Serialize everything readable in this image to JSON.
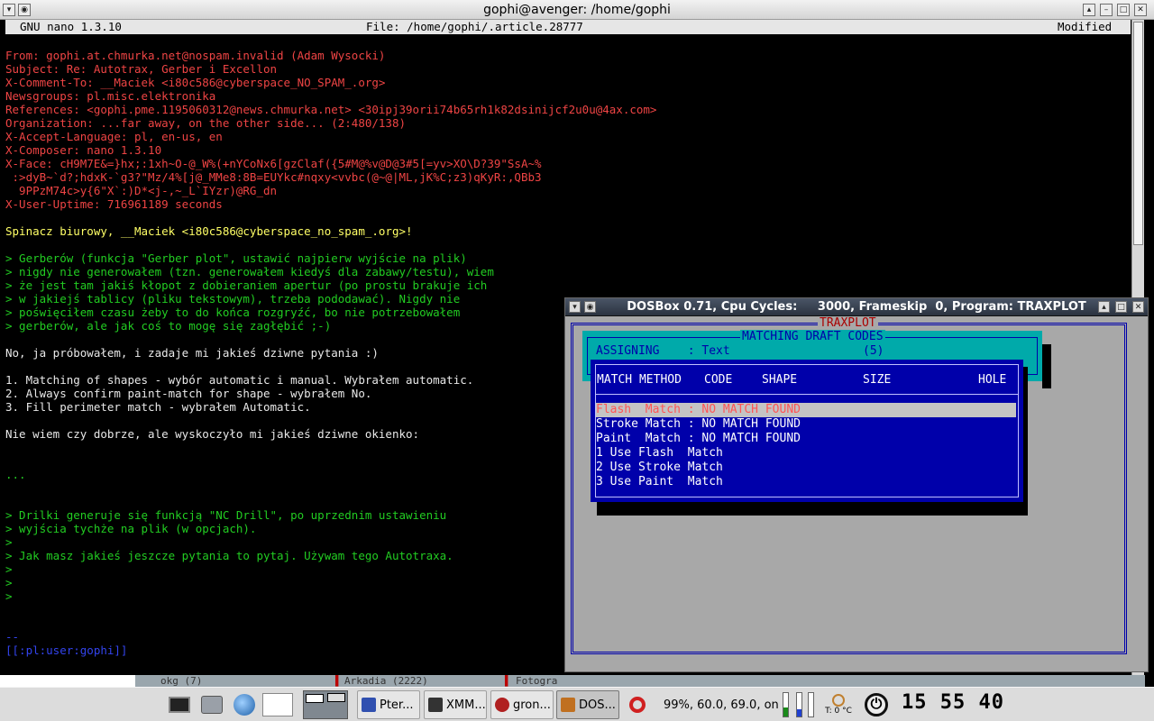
{
  "terminal": {
    "title": "gophi@avenger: /home/gophi",
    "nano": {
      "version": "GNU nano 1.3.10",
      "file": "File: /home/gophi/.article.28777",
      "status": "Modified"
    },
    "lines": [
      {
        "c": "red",
        "t": "From: gophi.at.chmurka.net@nospam.invalid (Adam Wysocki)"
      },
      {
        "c": "red",
        "t": "Subject: Re: Autotrax, Gerber i Excellon"
      },
      {
        "c": "red",
        "t": "X-Comment-To: __Maciek <i80c586@cyberspace_NO_SPAM_.org>"
      },
      {
        "c": "red",
        "t": "Newsgroups: pl.misc.elektronika"
      },
      {
        "c": "red",
        "t": "References: <gophi.pme.1195060312@news.chmurka.net> <30ipj39orii74b65rh1k82dsinijcf2u0u@4ax.com>"
      },
      {
        "c": "red",
        "t": "Organization: ...far away, on the other side... (2:480/138)"
      },
      {
        "c": "red",
        "t": "X-Accept-Language: pl, en-us, en"
      },
      {
        "c": "red",
        "t": "X-Composer: nano 1.3.10"
      },
      {
        "c": "red",
        "t": "X-Face: cH9M7E&=}hx;:1xh~O-@_W%(+nYCoNx6[gzClaf({5#M@%v@D@3#5[=yv>XO\\D?39\"SsA~%"
      },
      {
        "c": "red",
        "t": " :>dyB~`d?;hdxK-`g3?\"Mz/4%[j@_MMe8:8B=EUYkc#nqxy<vvbc(@~@|ML,jK%C;z3)qKyR:,QBb3"
      },
      {
        "c": "red",
        "t": "  9PPzM74c>y{6\"X`:)D*<j-,~_L`IYzr)@RG_dn"
      },
      {
        "c": "red",
        "t": "X-User-Uptime: 716961189 seconds"
      },
      {
        "c": "wht",
        "t": ""
      },
      {
        "c": "yel",
        "t": "Spinacz biurowy, __Maciek <i80c586@cyberspace_no_spam_.org>!"
      },
      {
        "c": "wht",
        "t": ""
      },
      {
        "c": "grn",
        "t": "> Gerberów (funkcja \"Gerber plot\", ustawić najpierw wyjście na plik)"
      },
      {
        "c": "grn",
        "t": "> nigdy nie generowałem (tzn. generowałem kiedyś dla zabawy/testu), wiem"
      },
      {
        "c": "grn",
        "t": "> że jest tam jakiś kłopot z dobieraniem apertur (po prostu brakuje ich"
      },
      {
        "c": "grn",
        "t": "> w jakiejś tablicy (pliku tekstowym), trzeba pododawać). Nigdy nie"
      },
      {
        "c": "grn",
        "t": "> poświęciłem czasu żeby to do końca rozgryźć, bo nie potrzebowałem"
      },
      {
        "c": "grn",
        "t": "> gerberów, ale jak coś to mogę się zagłębić ;-)"
      },
      {
        "c": "wht",
        "t": ""
      },
      {
        "c": "wht",
        "t": "No, ja próbowałem, i zadaje mi jakieś dziwne pytania :)"
      },
      {
        "c": "wht",
        "t": ""
      },
      {
        "c": "wht",
        "t": "1. Matching of shapes - wybór automatic i manual. Wybrałem automatic."
      },
      {
        "c": "wht",
        "t": "2. Always confirm paint-match for shape - wybrałem No."
      },
      {
        "c": "wht",
        "t": "3. Fill perimeter match - wybrałem Automatic."
      },
      {
        "c": "wht",
        "t": ""
      },
      {
        "c": "wht",
        "t": "Nie wiem czy dobrze, ale wyskoczyło mi jakieś dziwne okienko:"
      },
      {
        "c": "wht",
        "t": ""
      },
      {
        "c": "wht",
        "t": ""
      },
      {
        "c": "grn",
        "t": "..."
      },
      {
        "c": "wht",
        "t": ""
      },
      {
        "c": "wht",
        "t": ""
      },
      {
        "c": "grn",
        "t": "> Drilki generuje się funkcją \"NC Drill\", po uprzednim ustawieniu"
      },
      {
        "c": "grn",
        "t": "> wyjścia tychże na plik (w opcjach)."
      },
      {
        "c": "grn",
        "t": ">"
      },
      {
        "c": "grn",
        "t": "> Jak masz jakieś jeszcze pytania to pytaj. Używam tego Autotraxa."
      },
      {
        "c": "grn",
        "t": ">"
      },
      {
        "c": "grn",
        "t": ">"
      },
      {
        "c": "grn",
        "t": ">"
      },
      {
        "c": "wht",
        "t": ""
      },
      {
        "c": "wht",
        "t": ""
      },
      {
        "c": "blu",
        "t": "--"
      },
      {
        "c": "blu",
        "t": "[[:pl:user:gophi]]"
      }
    ],
    "tabs": [
      "okg (7)",
      "Arkadia (2222)",
      "Fotogra"
    ]
  },
  "dosbox": {
    "title": "DOSBox 0.71, Cpu Cycles:     3000, Frameskip  0, Program: TRAXPLOT",
    "program_title": "TRAXPLOT",
    "panel_title": "MATCHING DRAFT CODES",
    "assigning": "ASSIGNING    : Text",
    "assigning_count": "(5)",
    "columns": [
      "MATCH METHOD",
      "CODE",
      "SHAPE",
      "SIZE",
      "HOLE"
    ],
    "rows": [
      "Flash  Match : NO MATCH FOUND",
      "Stroke Match : NO MATCH FOUND",
      "Paint  Match : NO MATCH FOUND",
      "1 Use Flash  Match",
      "2 Use Stroke Match",
      "3 Use Paint  Match"
    ],
    "colors": {
      "blue": "#0000aa",
      "cyan": "#00aaaa",
      "highlight": "#ff5555"
    }
  },
  "taskbar": {
    "tasks": [
      "Pter...",
      "XMM...",
      "gron...",
      "DOS..."
    ],
    "cpu_status": "99%, 60.0, 69.0, on",
    "temp": "T: 0 °C",
    "clock": "15 55 40"
  }
}
